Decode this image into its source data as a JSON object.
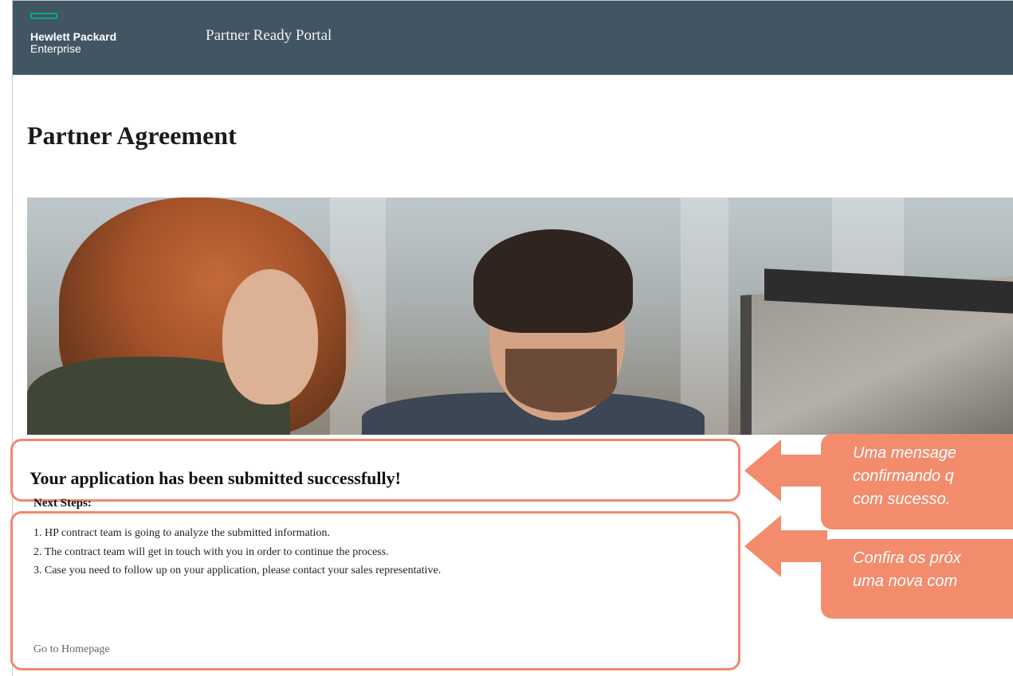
{
  "header": {
    "logo_line1": "Hewlett Packard",
    "logo_line2": "Enterprise",
    "portal_title": "Partner Ready Portal",
    "background_color": "#425563",
    "logo_accent_color": "#01a982"
  },
  "main": {
    "page_title": "Partner Agreement",
    "success_message": "Your application has been submitted successfully!",
    "next_steps_title": "Next Steps:",
    "steps": [
      "1. HP contract team is going to analyze the submitted information.",
      "2. The contract team will get in touch with you in order to continue the process.",
      "3. Case you need to follow up on your application, please contact your sales representative."
    ],
    "home_link": "Go to Homepage"
  },
  "annotations": {
    "callout1": [
      "Uma mensage",
      "confirmando q",
      "com sucesso."
    ],
    "callout2": [
      "Confira os próx",
      "uma nova com"
    ],
    "highlight_color": "#f0896c"
  }
}
